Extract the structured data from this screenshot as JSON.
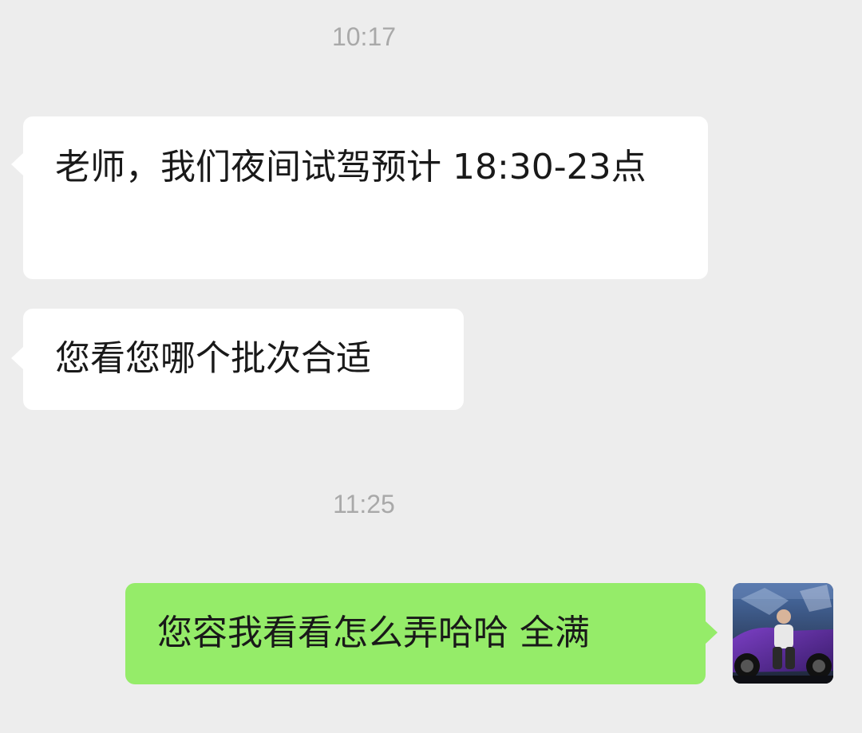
{
  "chat": {
    "timestamps": [
      "10:17",
      "11:25"
    ],
    "messages": [
      {
        "direction": "incoming",
        "text": "老师，我们夜间试驾预计 18:30-23点"
      },
      {
        "direction": "incoming",
        "text": "您看您哪个批次合适"
      },
      {
        "direction": "outgoing",
        "text": "您容我看看怎么弄哈哈 全满"
      }
    ]
  },
  "colors": {
    "background": "#ededed",
    "incoming_bubble": "#ffffff",
    "outgoing_bubble": "#95ec69",
    "timestamp_text": "#a9a9a9",
    "message_text": "#191919"
  },
  "avatar": {
    "icon": "user-avatar-photo"
  }
}
